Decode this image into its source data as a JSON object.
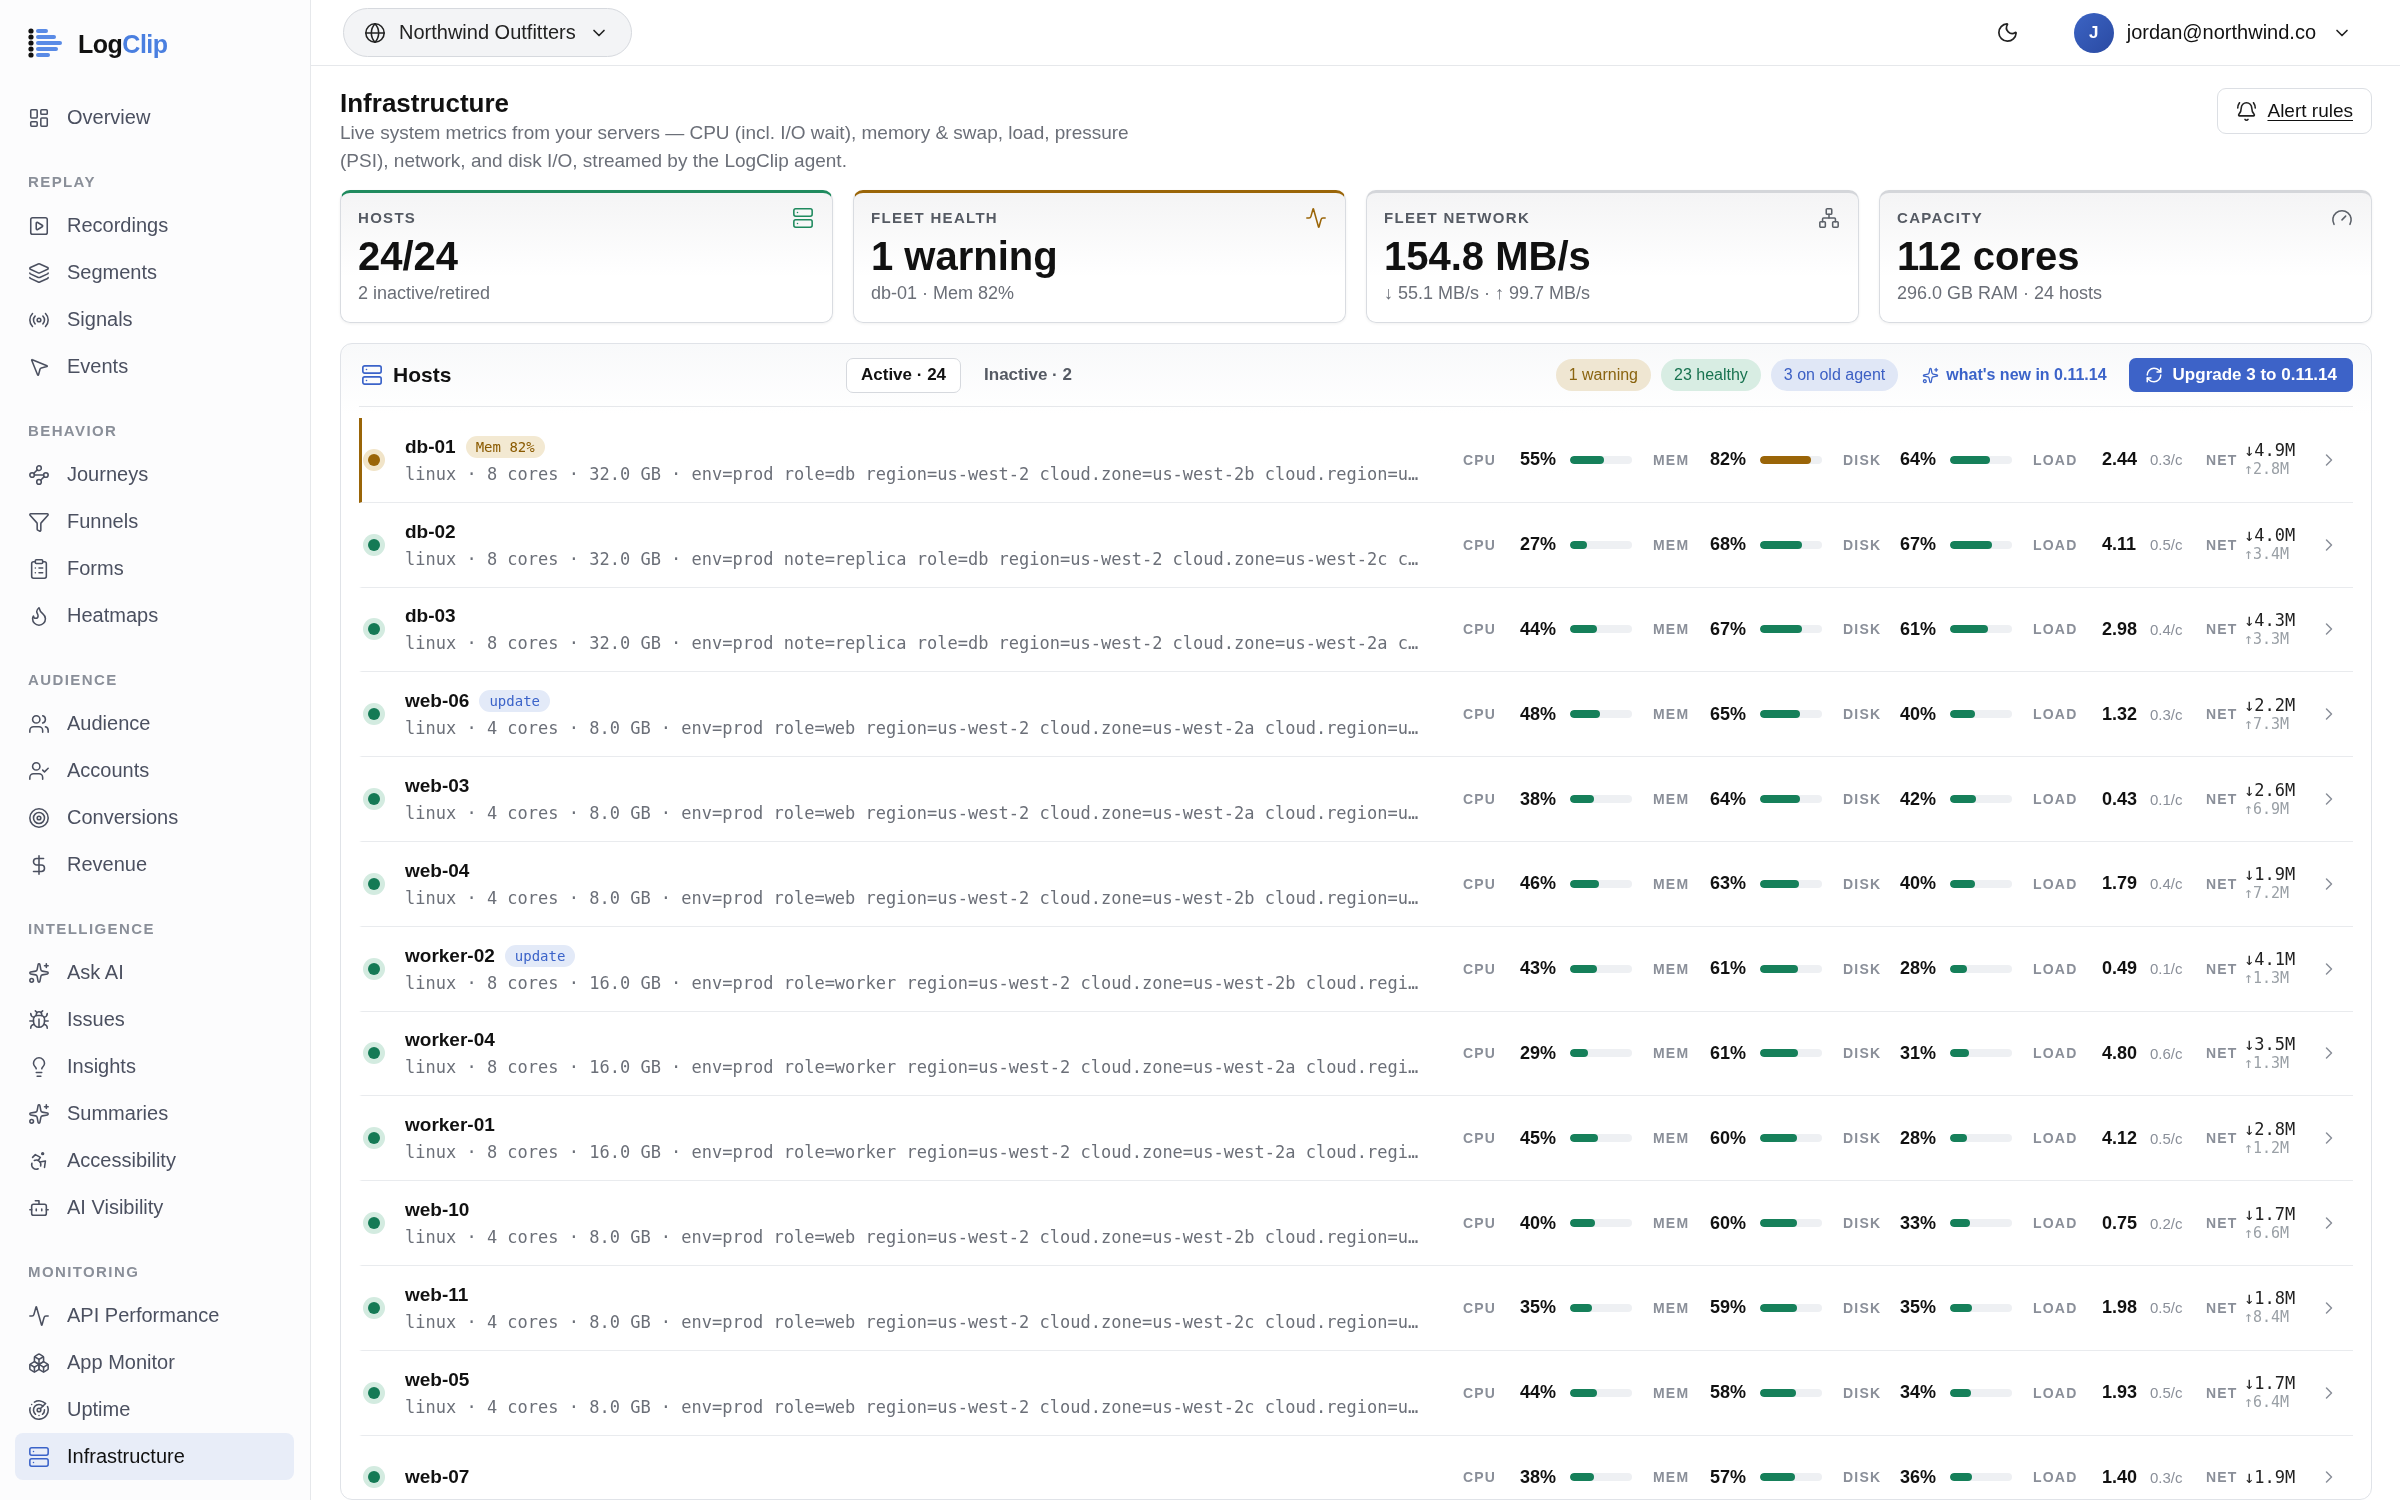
{
  "sidebar": {
    "logo": [
      "Log",
      "Clip"
    ],
    "sections": [
      {
        "items": [
          {
            "label": "Overview",
            "selected": false
          }
        ]
      },
      {
        "label": "REPLAY",
        "items": [
          {
            "label": "Recordings",
            "selected": false
          },
          {
            "label": "Segments",
            "selected": false
          },
          {
            "label": "Signals",
            "selected": false
          },
          {
            "label": "Events",
            "selected": false
          }
        ]
      },
      {
        "label": "BEHAVIOR",
        "items": [
          {
            "label": "Journeys",
            "selected": false
          },
          {
            "label": "Funnels",
            "selected": false
          },
          {
            "label": "Forms",
            "selected": false
          },
          {
            "label": "Heatmaps",
            "selected": false
          }
        ]
      },
      {
        "label": "AUDIENCE",
        "items": [
          {
            "label": "Audience",
            "selected": false
          },
          {
            "label": "Accounts",
            "selected": false
          },
          {
            "label": "Conversions",
            "selected": false
          },
          {
            "label": "Revenue",
            "selected": false
          }
        ]
      },
      {
        "label": "INTELLIGENCE",
        "items": [
          {
            "label": "Ask AI",
            "selected": false
          },
          {
            "label": "Issues",
            "selected": false
          },
          {
            "label": "Insights",
            "selected": false
          },
          {
            "label": "Summaries",
            "selected": false
          },
          {
            "label": "Accessibility",
            "selected": false
          },
          {
            "label": "AI Visibility",
            "selected": false
          }
        ]
      },
      {
        "label": "MONITORING",
        "items": [
          {
            "label": "API Performance",
            "selected": false
          },
          {
            "label": "App Monitor",
            "selected": false
          },
          {
            "label": "Uptime",
            "selected": false
          },
          {
            "label": "Infrastructure",
            "selected": true
          }
        ]
      }
    ]
  },
  "topbar": {
    "workspace": "Northwind Outfitters",
    "user": {
      "initial": "J",
      "email": "jordan@northwind.co"
    }
  },
  "page": {
    "title": "Infrastructure",
    "description": "Live system metrics from your servers — CPU (incl. I/O wait), memory & swap, load, pressure (PSI), network, and disk I/O, streamed by the LogClip agent.",
    "action": "Alert rules"
  },
  "cards": [
    {
      "label": "HOSTS",
      "value": "24/24",
      "sub": "2 inactive/retired",
      "color": "#1f8a5e"
    },
    {
      "label": "FLEET HEALTH",
      "value": "1 warning",
      "sub": "db-01 · Mem 82%",
      "color": "#9a6508"
    },
    {
      "label": "FLEET NETWORK",
      "value": "154.8 MB/s",
      "sub": "↓ 55.1 MB/s · ↑ 99.7 MB/s"
    },
    {
      "label": "CAPACITY",
      "value": "112 cores",
      "sub": "296.0 GB RAM · 24 hosts"
    }
  ],
  "hosts": {
    "title": "Hosts",
    "tabs": [
      {
        "label": "Active · 24",
        "selected": true
      },
      {
        "label": "Inactive · 2",
        "selected": false
      }
    ],
    "pills": [
      {
        "text": "1 warning",
        "kind": "warning"
      },
      {
        "text": "23 healthy",
        "kind": "healthy"
      },
      {
        "text": "3 on old agent",
        "kind": "outdated"
      }
    ],
    "link": "what's new in 0.11.14",
    "button": "Upgrade 3 to 0.11.14",
    "rows": [
      {
        "name": "db-01",
        "warning": true,
        "badge": {
          "text": "Mem 82%",
          "kind": "alert"
        },
        "details": "linux · 8 cores · 32.0 GB · env=prod role=db region=us-west-2 cloud.zone=us-west-2b cloud.region=u…",
        "metrics": [
          {
            "kind": "bar",
            "label": "CPU",
            "value": "55%",
            "level": 0.55,
            "warning": false
          },
          {
            "kind": "bar",
            "label": "MEM",
            "value": "82%",
            "level": 0.82,
            "warning": true
          },
          {
            "kind": "bar",
            "label": "DISK",
            "value": "64%",
            "level": 0.64,
            "warning": false
          },
          {
            "kind": "load",
            "label": "LOAD",
            "value": "2.44",
            "per_core": "0.3/c"
          },
          {
            "kind": "net",
            "label": "NET",
            "down": "↓4.9M",
            "up": "↑2.8M"
          }
        ]
      },
      {
        "name": "db-02",
        "warning": false,
        "details": "linux · 8 cores · 32.0 GB · env=prod note=replica role=db region=us-west-2 cloud.zone=us-west-2c c…",
        "metrics": [
          {
            "kind": "bar",
            "label": "CPU",
            "value": "27%",
            "level": 0.27,
            "warning": false
          },
          {
            "kind": "bar",
            "label": "MEM",
            "value": "68%",
            "level": 0.68,
            "warning": false
          },
          {
            "kind": "bar",
            "label": "DISK",
            "value": "67%",
            "level": 0.67,
            "warning": false
          },
          {
            "kind": "load",
            "label": "LOAD",
            "value": "4.11",
            "per_core": "0.5/c"
          },
          {
            "kind": "net",
            "label": "NET",
            "down": "↓4.0M",
            "up": "↑3.4M"
          }
        ]
      },
      {
        "name": "db-03",
        "warning": false,
        "details": "linux · 8 cores · 32.0 GB · env=prod note=replica role=db region=us-west-2 cloud.zone=us-west-2a c…",
        "metrics": [
          {
            "kind": "bar",
            "label": "CPU",
            "value": "44%",
            "level": 0.44,
            "warning": false
          },
          {
            "kind": "bar",
            "label": "MEM",
            "value": "67%",
            "level": 0.67,
            "warning": false
          },
          {
            "kind": "bar",
            "label": "DISK",
            "value": "61%",
            "level": 0.61,
            "warning": false
          },
          {
            "kind": "load",
            "label": "LOAD",
            "value": "2.98",
            "per_core": "0.4/c"
          },
          {
            "kind": "net",
            "label": "NET",
            "down": "↓4.3M",
            "up": "↑3.3M"
          }
        ]
      },
      {
        "name": "web-06",
        "warning": false,
        "badge": {
          "text": "update",
          "kind": "update"
        },
        "details": "linux · 4 cores · 8.0 GB · env=prod role=web region=us-west-2 cloud.zone=us-west-2a cloud.region=u…",
        "metrics": [
          {
            "kind": "bar",
            "label": "CPU",
            "value": "48%",
            "level": 0.48,
            "warning": false
          },
          {
            "kind": "bar",
            "label": "MEM",
            "value": "65%",
            "level": 0.65,
            "warning": false
          },
          {
            "kind": "bar",
            "label": "DISK",
            "value": "40%",
            "level": 0.4,
            "warning": false
          },
          {
            "kind": "load",
            "label": "LOAD",
            "value": "1.32",
            "per_core": "0.3/c"
          },
          {
            "kind": "net",
            "label": "NET",
            "down": "↓2.2M",
            "up": "↑7.3M"
          }
        ]
      },
      {
        "name": "web-03",
        "warning": false,
        "details": "linux · 4 cores · 8.0 GB · env=prod role=web region=us-west-2 cloud.zone=us-west-2a cloud.region=u…",
        "metrics": [
          {
            "kind": "bar",
            "label": "CPU",
            "value": "38%",
            "level": 0.38,
            "warning": false
          },
          {
            "kind": "bar",
            "label": "MEM",
            "value": "64%",
            "level": 0.64,
            "warning": false
          },
          {
            "kind": "bar",
            "label": "DISK",
            "value": "42%",
            "level": 0.42,
            "warning": false
          },
          {
            "kind": "load",
            "label": "LOAD",
            "value": "0.43",
            "per_core": "0.1/c"
          },
          {
            "kind": "net",
            "label": "NET",
            "down": "↓2.6M",
            "up": "↑6.9M"
          }
        ]
      },
      {
        "name": "web-04",
        "warning": false,
        "details": "linux · 4 cores · 8.0 GB · env=prod role=web region=us-west-2 cloud.zone=us-west-2b cloud.region=u…",
        "metrics": [
          {
            "kind": "bar",
            "label": "CPU",
            "value": "46%",
            "level": 0.46,
            "warning": false
          },
          {
            "kind": "bar",
            "label": "MEM",
            "value": "63%",
            "level": 0.63,
            "warning": false
          },
          {
            "kind": "bar",
            "label": "DISK",
            "value": "40%",
            "level": 0.4,
            "warning": false
          },
          {
            "kind": "load",
            "label": "LOAD",
            "value": "1.79",
            "per_core": "0.4/c"
          },
          {
            "kind": "net",
            "label": "NET",
            "down": "↓1.9M",
            "up": "↑7.2M"
          }
        ]
      },
      {
        "name": "worker-02",
        "warning": false,
        "badge": {
          "text": "update",
          "kind": "update"
        },
        "details": "linux · 8 cores · 16.0 GB · env=prod role=worker region=us-west-2 cloud.zone=us-west-2b cloud.regi…",
        "metrics": [
          {
            "kind": "bar",
            "label": "CPU",
            "value": "43%",
            "level": 0.43,
            "warning": false
          },
          {
            "kind": "bar",
            "label": "MEM",
            "value": "61%",
            "level": 0.61,
            "warning": false
          },
          {
            "kind": "bar",
            "label": "DISK",
            "value": "28%",
            "level": 0.28,
            "warning": false
          },
          {
            "kind": "load",
            "label": "LOAD",
            "value": "0.49",
            "per_core": "0.1/c"
          },
          {
            "kind": "net",
            "label": "NET",
            "down": "↓4.1M",
            "up": "↑1.3M"
          }
        ]
      },
      {
        "name": "worker-04",
        "warning": false,
        "details": "linux · 8 cores · 16.0 GB · env=prod role=worker region=us-west-2 cloud.zone=us-west-2a cloud.regi…",
        "metrics": [
          {
            "kind": "bar",
            "label": "CPU",
            "value": "29%",
            "level": 0.29,
            "warning": false
          },
          {
            "kind": "bar",
            "label": "MEM",
            "value": "61%",
            "level": 0.61,
            "warning": false
          },
          {
            "kind": "bar",
            "label": "DISK",
            "value": "31%",
            "level": 0.31,
            "warning": false
          },
          {
            "kind": "load",
            "label": "LOAD",
            "value": "4.80",
            "per_core": "0.6/c"
          },
          {
            "kind": "net",
            "label": "NET",
            "down": "↓3.5M",
            "up": "↑1.3M"
          }
        ]
      },
      {
        "name": "worker-01",
        "warning": false,
        "details": "linux · 8 cores · 16.0 GB · env=prod role=worker region=us-west-2 cloud.zone=us-west-2a cloud.regi…",
        "metrics": [
          {
            "kind": "bar",
            "label": "CPU",
            "value": "45%",
            "level": 0.45,
            "warning": false
          },
          {
            "kind": "bar",
            "label": "MEM",
            "value": "60%",
            "level": 0.6,
            "warning": false
          },
          {
            "kind": "bar",
            "label": "DISK",
            "value": "28%",
            "level": 0.28,
            "warning": false
          },
          {
            "kind": "load",
            "label": "LOAD",
            "value": "4.12",
            "per_core": "0.5/c"
          },
          {
            "kind": "net",
            "label": "NET",
            "down": "↓2.8M",
            "up": "↑1.2M"
          }
        ]
      },
      {
        "name": "web-10",
        "warning": false,
        "details": "linux · 4 cores · 8.0 GB · env=prod role=web region=us-west-2 cloud.zone=us-west-2b cloud.region=u…",
        "metrics": [
          {
            "kind": "bar",
            "label": "CPU",
            "value": "40%",
            "level": 0.4,
            "warning": false
          },
          {
            "kind": "bar",
            "label": "MEM",
            "value": "60%",
            "level": 0.6,
            "warning": false
          },
          {
            "kind": "bar",
            "label": "DISK",
            "value": "33%",
            "level": 0.33,
            "warning": false
          },
          {
            "kind": "load",
            "label": "LOAD",
            "value": "0.75",
            "per_core": "0.2/c"
          },
          {
            "kind": "net",
            "label": "NET",
            "down": "↓1.7M",
            "up": "↑6.6M"
          }
        ]
      },
      {
        "name": "web-11",
        "warning": false,
        "details": "linux · 4 cores · 8.0 GB · env=prod role=web region=us-west-2 cloud.zone=us-west-2c cloud.region=u…",
        "metrics": [
          {
            "kind": "bar",
            "label": "CPU",
            "value": "35%",
            "level": 0.35,
            "warning": false
          },
          {
            "kind": "bar",
            "label": "MEM",
            "value": "59%",
            "level": 0.59,
            "warning": false
          },
          {
            "kind": "bar",
            "label": "DISK",
            "value": "35%",
            "level": 0.35,
            "warning": false
          },
          {
            "kind": "load",
            "label": "LOAD",
            "value": "1.98",
            "per_core": "0.5/c"
          },
          {
            "kind": "net",
            "label": "NET",
            "down": "↓1.8M",
            "up": "↑8.4M"
          }
        ]
      },
      {
        "name": "web-05",
        "warning": false,
        "details": "linux · 4 cores · 8.0 GB · env=prod role=web region=us-west-2 cloud.zone=us-west-2c cloud.region=u…",
        "metrics": [
          {
            "kind": "bar",
            "label": "CPU",
            "value": "44%",
            "level": 0.44,
            "warning": false
          },
          {
            "kind": "bar",
            "label": "MEM",
            "value": "58%",
            "level": 0.58,
            "warning": false
          },
          {
            "kind": "bar",
            "label": "DISK",
            "value": "34%",
            "level": 0.34,
            "warning": false
          },
          {
            "kind": "load",
            "label": "LOAD",
            "value": "1.93",
            "per_core": "0.5/c"
          },
          {
            "kind": "net",
            "label": "NET",
            "down": "↓1.7M",
            "up": "↑6.4M"
          }
        ]
      },
      {
        "name": "web-07",
        "warning": false,
        "metrics": [
          {
            "kind": "bar",
            "label": "CPU",
            "value": "38%",
            "level": 0.38,
            "warning": false
          },
          {
            "kind": "bar",
            "label": "MEM",
            "value": "57%",
            "level": 0.57,
            "warning": false
          },
          {
            "kind": "bar",
            "label": "DISK",
            "value": "36%",
            "level": 0.36,
            "warning": false
          },
          {
            "kind": "load",
            "label": "LOAD",
            "value": "1.40",
            "per_core": "0.3/c"
          },
          {
            "kind": "net",
            "label": "NET",
            "down": "↓1.9M"
          }
        ]
      }
    ]
  }
}
